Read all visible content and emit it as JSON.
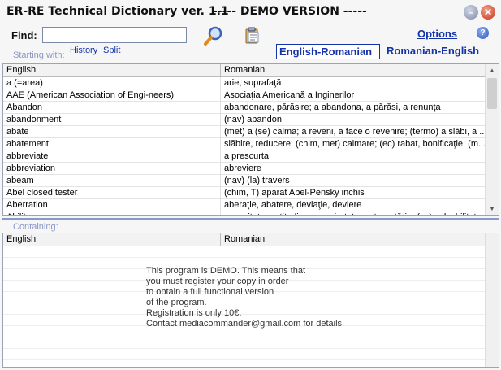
{
  "window": {
    "title": "ER-RE Technical Dictionary ver. 1.1",
    "demo_banner": "----- DEMO VERSION -----",
    "minimize_glyph": "–",
    "close_glyph": "✕"
  },
  "toolbar": {
    "find_label": "Find:",
    "find_value": "",
    "search_icon": "magnifier-icon",
    "clipboard_icon": "clipboard-icon",
    "options_label": "Options",
    "help_glyph": "?"
  },
  "starting": {
    "label": "Starting with:",
    "history_link": "History",
    "split_link": "Split"
  },
  "languages": {
    "selected": "English-Romanian",
    "alternate": "Romanian-English"
  },
  "top_table": {
    "columns": [
      "English",
      "Romanian"
    ],
    "rows": [
      [
        "a (=area)",
        "arie, suprafaţă"
      ],
      [
        "AAE (American Association of Engi-neers)",
        "Asociaţia Americană a Inginerilor"
      ],
      [
        "Abandon",
        "abandonare, părăsire; a abandona, a părăsi, a renunţa"
      ],
      [
        "abandonment",
        "(nav) abandon"
      ],
      [
        "abate",
        "(met) a (se) calma; a reveni, a face o revenire; (termo) a slăbi, a ..."
      ],
      [
        "abatement",
        "slăbire, reducere; (chim, met) calmare; (ec) rabat, bonificaţie; (m..."
      ],
      [
        "abbreviate",
        "a prescurta"
      ],
      [
        "abbreviation",
        "abreviere"
      ],
      [
        "abeam",
        "(nav) (la) travers"
      ],
      [
        "Abel closed tester",
        "(chim, T) aparat Abel-Pensky inchis"
      ],
      [
        "Aberration",
        "aberaţie, abatere, deviaţie, deviere"
      ],
      [
        "Ability",
        "capacitate, aptitudine, proprie-tate; putere; tărie; (ec) solvabilitate"
      ]
    ]
  },
  "containing": {
    "label": "Containing:"
  },
  "bottom_table": {
    "columns": [
      "English",
      "Romanian"
    ],
    "demo_message": [
      "This program is DEMO. This means that",
      "you must register your copy in order",
      "to obtain a full functional version",
      "of the program.",
      "Registration is only 10€.",
      "Contact mediacommander@gmail.com for details."
    ]
  },
  "colors": {
    "accent": "#1433a8",
    "label_muted": "#8a97c8",
    "close": "#c6361c"
  }
}
